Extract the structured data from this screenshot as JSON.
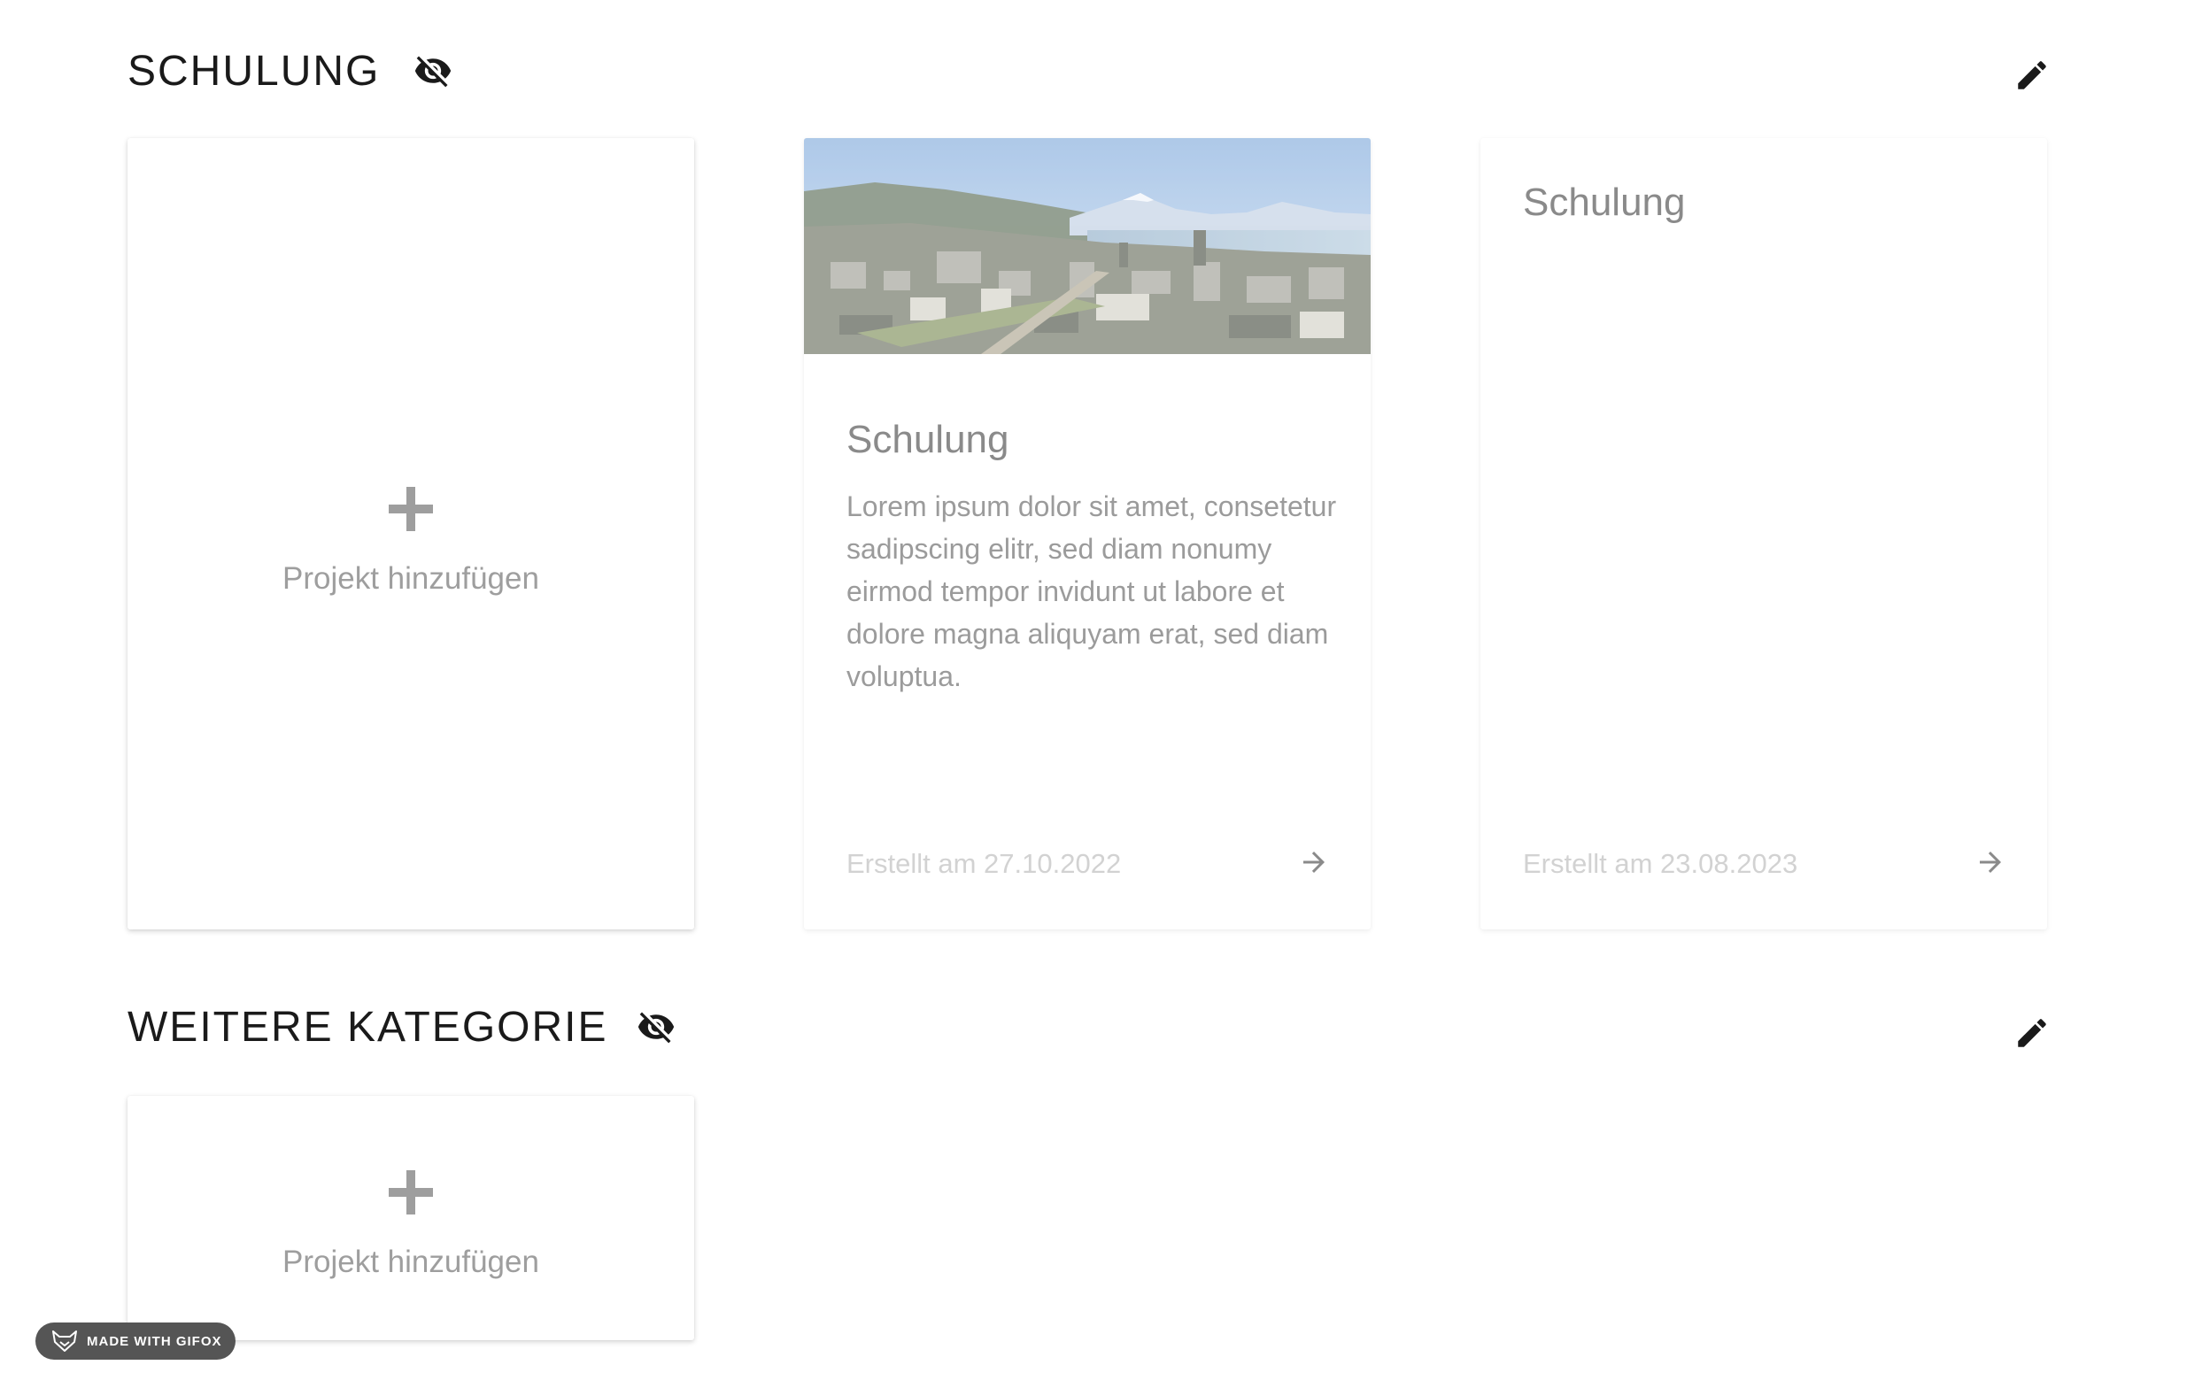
{
  "sections": [
    {
      "title": "SCHULUNG",
      "add_project_label": "Projekt hinzufügen",
      "projects": [
        {
          "title": "Schulung",
          "description": "Lorem ipsum dolor sit amet, consetetur sadipscing elitr, sed diam nonumy eirmod tempor invidunt ut labore et dolore magna aliquyam erat, sed diam voluptua.",
          "created": "Erstellt am 27.10.2022",
          "image": "city-lake-panorama"
        },
        {
          "title": "Schulung",
          "description": "",
          "created": "Erstellt am 23.08.2023"
        }
      ]
    },
    {
      "title": "WEITERE KATEGORIE",
      "add_project_label": "Projekt hinzufügen",
      "projects": []
    }
  ],
  "badge": {
    "label": "MADE WITH GIFOX"
  },
  "icons": {
    "visibility": "eye-off-icon",
    "edit": "pencil-icon",
    "open": "arrow-right-icon",
    "add": "plus-icon",
    "badge": "fox-icon"
  },
  "colors": {
    "heading": "#1a1a1a",
    "muted_text": "#9e9e9e",
    "date_text": "#d2d2d2",
    "badge_bg": "#555555"
  }
}
